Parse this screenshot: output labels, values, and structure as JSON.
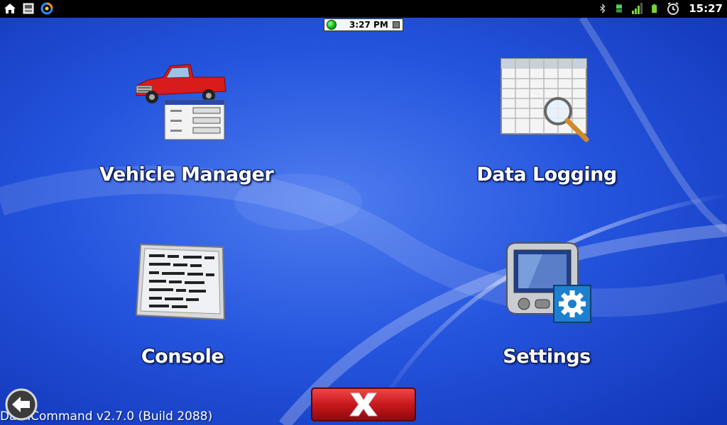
{
  "status_bar": {
    "clock": "15:27",
    "left_icons": [
      "home-icon",
      "sd-card-icon",
      "sync-icon"
    ],
    "right_icons": [
      "bluetooth-icon",
      "usb-debug-icon",
      "signal-icon",
      "battery-icon",
      "alarm-icon"
    ]
  },
  "header": {
    "time": "3:27 PM"
  },
  "menu": {
    "vehicle_manager": "Vehicle Manager",
    "data_logging": "Data Logging",
    "console": "Console",
    "settings": "Settings"
  },
  "footer": {
    "version": "DashCommand v2.7.0 (Build 2088)"
  },
  "colors": {
    "background": "#1b49d6",
    "close_button": "#c8181c",
    "status_led": "#00b300"
  }
}
